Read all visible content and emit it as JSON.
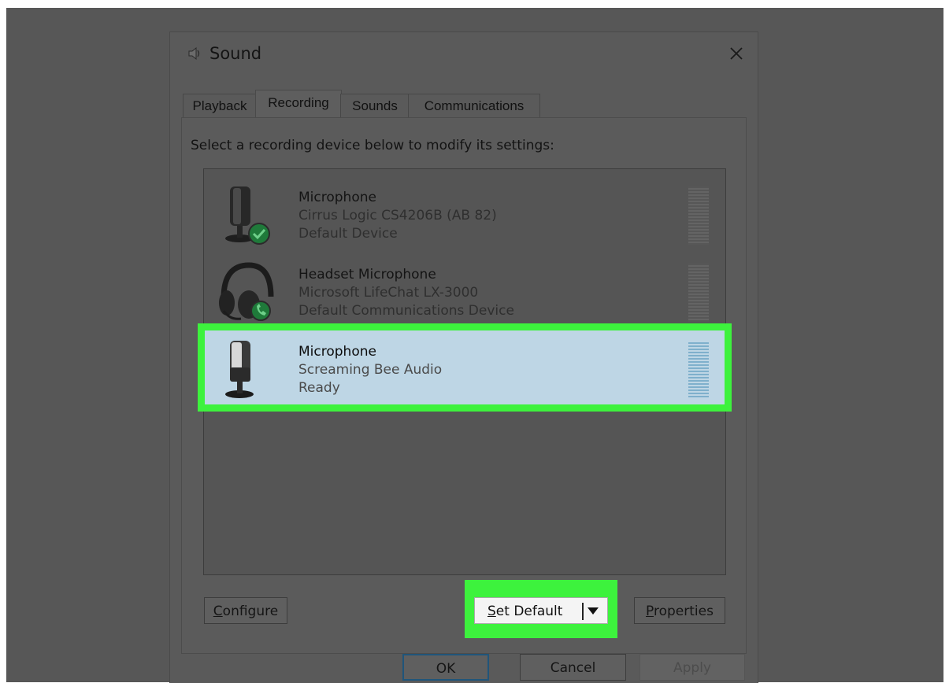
{
  "window": {
    "title": "Sound",
    "close_glyph": "✕"
  },
  "tabs": [
    {
      "label": "Playback"
    },
    {
      "label": "Recording",
      "active": true
    },
    {
      "label": "Sounds"
    },
    {
      "label": "Communications"
    }
  ],
  "instruction": "Select a recording device below to modify its settings:",
  "devices": [
    {
      "name": "Microphone",
      "detail": "Cirrus Logic CS4206B (AB 82)",
      "status": "Default Device",
      "icon": "microphone-icon",
      "badge": "check-badge-icon"
    },
    {
      "name": "Headset Microphone",
      "detail": "Microsoft LifeChat LX-3000",
      "status": "Default Communications Device",
      "icon": "headset-icon",
      "badge": "phone-badge-icon"
    },
    {
      "name": "Microphone",
      "detail": "Screaming Bee Audio",
      "status": "Ready",
      "icon": "microphone-icon",
      "selected": true
    }
  ],
  "buttons": {
    "configure": {
      "accesskey": "C",
      "rest": "onfigure"
    },
    "set_default": {
      "accesskey": "S",
      "rest": "et Default"
    },
    "properties": {
      "accesskey": "P",
      "rest": "roperties"
    },
    "ok": "OK",
    "cancel": "Cancel",
    "apply": "Apply"
  },
  "colors": {
    "highlight": "#3df23d",
    "selected_row": "#bed6e5",
    "badge_green": "#1f7a3a",
    "overlay": "#575757"
  }
}
